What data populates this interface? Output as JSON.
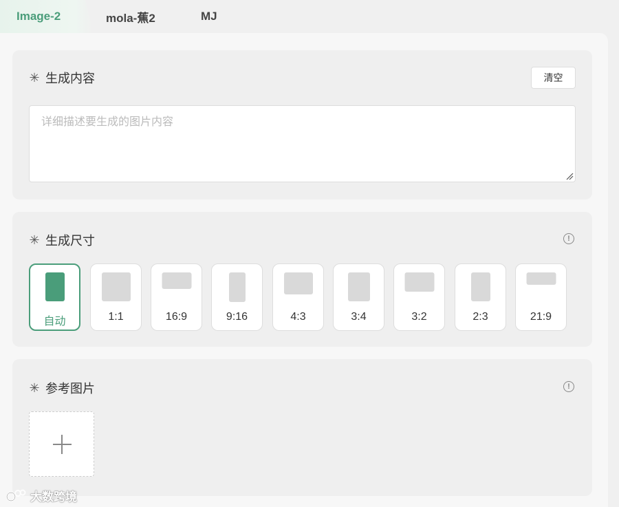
{
  "tabs": [
    {
      "label": "Image-2",
      "active": true
    },
    {
      "label": "mola-蕉2",
      "active": false
    },
    {
      "label": "MJ",
      "active": false
    }
  ],
  "content_section": {
    "title": "生成内容",
    "required_mark": "✳",
    "clear_label": "清空",
    "prompt_placeholder": "详细描述要生成的图片内容",
    "prompt_value": ""
  },
  "size_section": {
    "title": "生成尺寸",
    "required_mark": "✳",
    "info_icon": "!",
    "options": [
      {
        "label": "自动",
        "selected": true
      },
      {
        "label": "1:1",
        "selected": false
      },
      {
        "label": "16:9",
        "selected": false
      },
      {
        "label": "9:16",
        "selected": false
      },
      {
        "label": "4:3",
        "selected": false
      },
      {
        "label": "3:4",
        "selected": false
      },
      {
        "label": "3:2",
        "selected": false
      },
      {
        "label": "2:3",
        "selected": false
      },
      {
        "label": "21:9",
        "selected": false
      }
    ]
  },
  "reference_section": {
    "title": "参考图片",
    "required_mark": "✳",
    "info_icon": "!",
    "upload_icon": "plus-icon"
  },
  "watermark": {
    "text": "大数跨境"
  },
  "colors": {
    "accent": "#4a9d7a",
    "card_bg": "#efefef",
    "shape_gray": "#d9d9d9"
  }
}
